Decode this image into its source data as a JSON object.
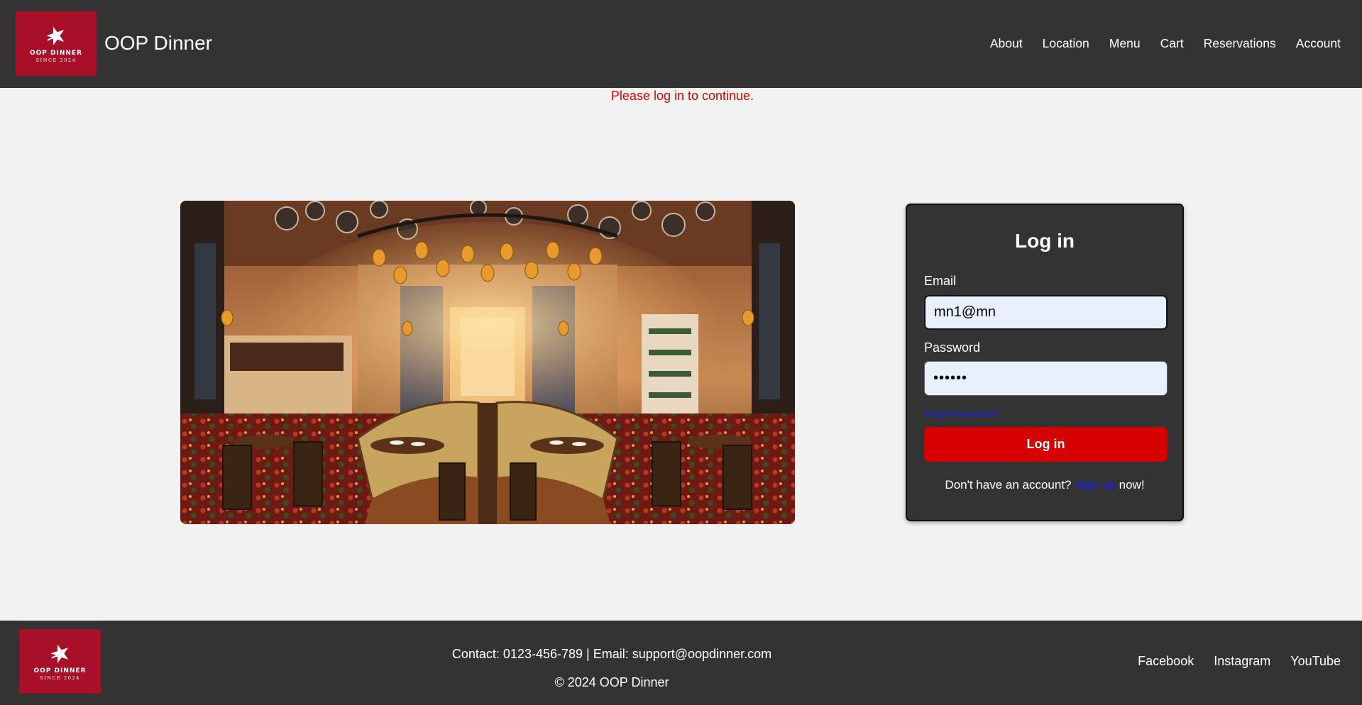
{
  "brand": {
    "logo_name": "OOP DINNER",
    "logo_since": "SINCE 2024",
    "title": "OOP Dinner",
    "color": "#a8102a"
  },
  "nav": {
    "items": [
      {
        "label": "About"
      },
      {
        "label": "Location"
      },
      {
        "label": "Menu"
      },
      {
        "label": "Cart"
      },
      {
        "label": "Reservations"
      },
      {
        "label": "Account"
      }
    ]
  },
  "flash_message": "Please log in to continue.",
  "hero": {
    "image_icon": "restaurant-interior-image"
  },
  "login": {
    "title": "Log in",
    "email_label": "Email",
    "email_value": "mn1@mn",
    "password_label": "Password",
    "password_value": "••••••",
    "forgot_label": "Forgot Password?",
    "submit_label": "Log in",
    "signup_prefix": "Don't have an account? ",
    "signup_link": "Sign up",
    "signup_suffix": " now!",
    "button_color": "#d60000",
    "link_color": "#1a1aff"
  },
  "footer": {
    "contact": "Contact: 0123-456-789 | Email: support@oopdinner.com",
    "copyright": "© 2024 OOP Dinner",
    "social": [
      {
        "label": "Facebook"
      },
      {
        "label": "Instagram"
      },
      {
        "label": "YouTube"
      }
    ]
  },
  "colors": {
    "header_bg": "#333333",
    "page_bg": "#f2f2f2",
    "flash": "#e00000"
  }
}
